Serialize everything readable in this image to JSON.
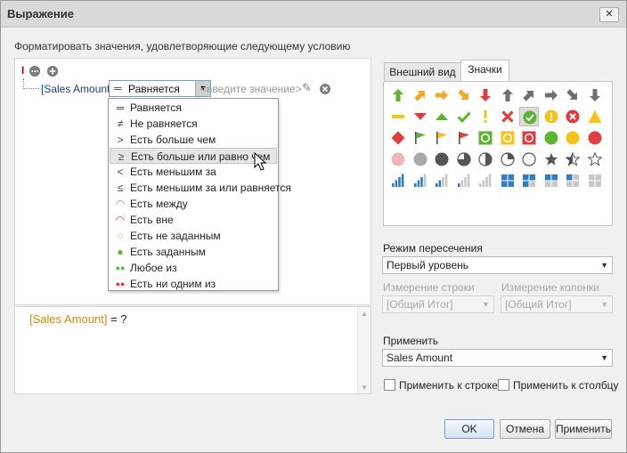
{
  "window": {
    "title": "Выражение",
    "close_glyph": "✕"
  },
  "caption": "Форматировать значения, удовлетворяющие следующему условию",
  "tree": {
    "root_mark": "I",
    "field": "[Sales Amount]",
    "operator": "Равняется",
    "value_placeholder": "<введите значение>"
  },
  "operators": [
    {
      "icon": "equals-icon",
      "glyph": "═",
      "label": "Равняется"
    },
    {
      "icon": "not-equal-icon",
      "glyph": "≠",
      "label": "Не равняется"
    },
    {
      "icon": "greater-icon",
      "glyph": ">",
      "label": "Есть больше чем"
    },
    {
      "icon": "greater-or-equal-icon",
      "glyph": "≥",
      "label": "Есть больше или равно чем"
    },
    {
      "icon": "less-icon",
      "glyph": "<",
      "label": "Есть меньшим за"
    },
    {
      "icon": "less-or-equal-icon",
      "glyph": "≤",
      "label": "Есть меньшим за или равняется"
    },
    {
      "icon": "between-icon",
      "glyph": "◠",
      "label": "Есть между"
    },
    {
      "icon": "not-between-icon",
      "glyph": "◠",
      "label": "Есть вне"
    },
    {
      "icon": "is-null-icon",
      "glyph": "◌",
      "label": "Есть не заданным"
    },
    {
      "icon": "is-not-null-icon",
      "glyph": "●",
      "label": "Есть заданным"
    },
    {
      "icon": "any-of-icon",
      "glyph": "●●",
      "label": "Любое из"
    },
    {
      "icon": "none-of-icon",
      "glyph": "●●",
      "label": "Есть ни одним из"
    }
  ],
  "highlighted_operator_index": 3,
  "expression": {
    "field": "[Sales Amount]",
    "rest": " = ?"
  },
  "tabs": [
    {
      "label": "Внешний вид"
    },
    {
      "label": "Значки"
    }
  ],
  "active_tab_index": 1,
  "icon_set": [
    [
      "arrow-up-green-icon",
      "arrow-up-right-orange-icon",
      "arrow-right-orange-icon",
      "arrow-down-right-orange-icon",
      "arrow-down-red-icon",
      "arrow-up-gray-icon",
      "arrow-up-right-gray-icon",
      "arrow-right-gray-icon",
      "arrow-down-right-gray-icon",
      "arrow-down-gray-icon"
    ],
    [
      "dash-yellow-icon",
      "triangle-down-red-icon",
      "triangle-up-green-icon",
      "check-green-icon",
      "exclamation-yellow-icon",
      "cross-red-icon",
      "circle-check-green-icon",
      "circle-exclamation-yellow-icon",
      "circle-cross-red-icon",
      "triangle-yellow-icon"
    ],
    [
      "diamond-red-icon",
      "flag-green-icon",
      "flag-yellow-icon",
      "flag-red-icon",
      "square-circle-green-icon",
      "square-circle-yellow-icon",
      "square-circle-red-icon",
      "circle-green-icon",
      "circle-yellow-icon",
      "circle-red-icon"
    ],
    [
      "circle-pink-icon",
      "circle-gray-icon",
      "circle-dark-icon",
      "pie-three-quarter-icon",
      "pie-half-icon",
      "pie-quarter-icon",
      "circle-empty-icon",
      "star-full-icon",
      "star-half-icon",
      "star-empty-icon"
    ],
    [
      "signal-4-icon",
      "signal-3-icon",
      "signal-2-icon",
      "signal-1-icon",
      "signal-0-icon",
      "boxes-4-icon",
      "boxes-3-icon",
      "boxes-2-icon",
      "boxes-1-icon",
      "boxes-0-icon"
    ]
  ],
  "selected_icon": "circle-check-green-icon",
  "intersection": {
    "label": "Режим пересечения",
    "value": "Первый уровень"
  },
  "row_dim": {
    "label": "Измерение строки",
    "value": "[Общий Итог]"
  },
  "col_dim": {
    "label": "Измерение колонки",
    "value": "[Общий Итог]"
  },
  "apply_to": {
    "label": "Применить",
    "value": "Sales Amount"
  },
  "apply_row_label": "Применить к строке",
  "apply_col_label": "Применить к столбцу",
  "buttons": {
    "ok": "OK",
    "cancel": "Отмена",
    "apply": "Применить"
  },
  "colors": {
    "green": "#5cb531",
    "orange": "#f5a623",
    "red": "#e23c3c",
    "yellow": "#f7c21a",
    "gray": "#6f6f6f",
    "blue": "#2d7fc1",
    "link": "#1d3f8a",
    "field_orange": "#d88a00"
  }
}
